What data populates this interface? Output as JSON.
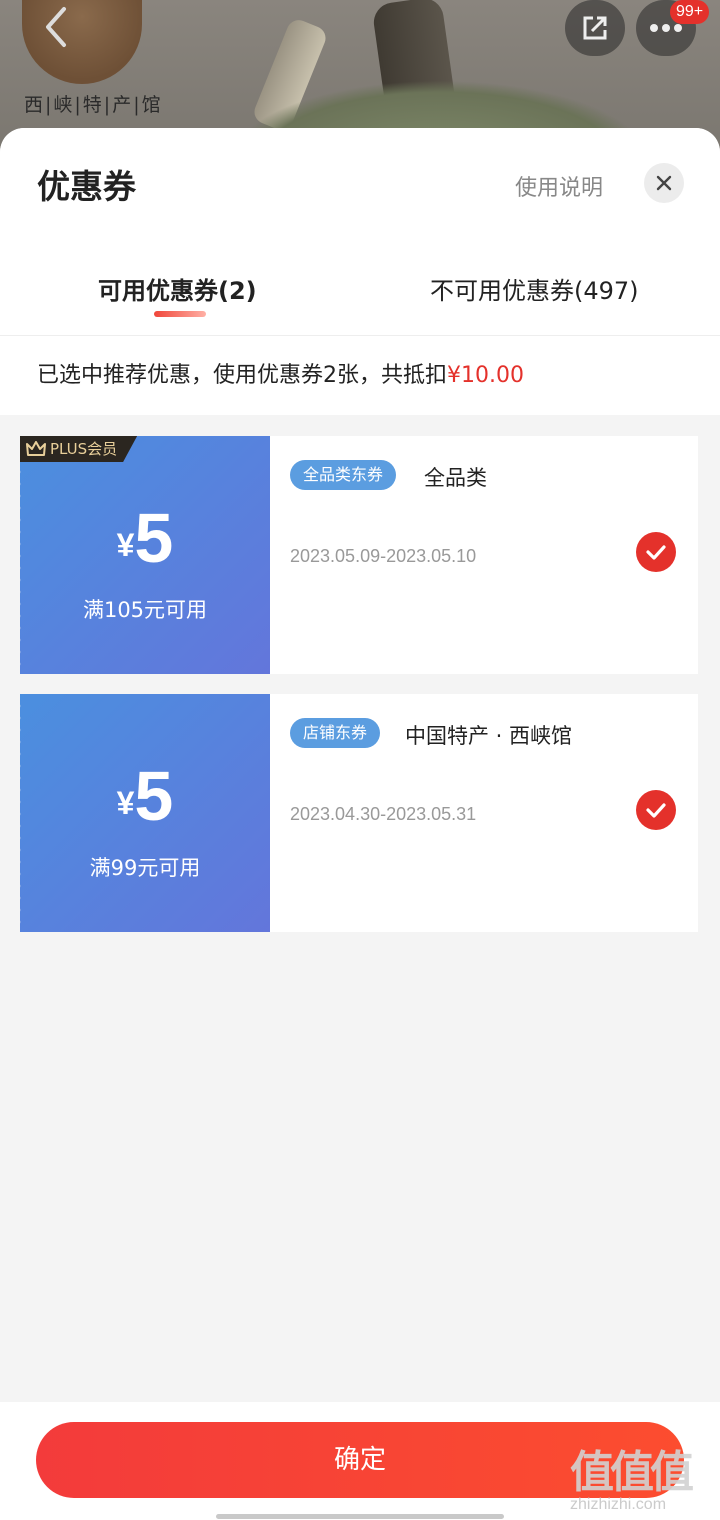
{
  "background": {
    "store_logo_text": "西|峡|特|产|馆",
    "more_badge": "99+"
  },
  "sheet": {
    "title": "优惠券",
    "help_link": "使用说明",
    "tabs": [
      {
        "label": "可用优惠券(2)",
        "active": true
      },
      {
        "label": "不可用优惠券(497)",
        "active": false
      }
    ],
    "summary": {
      "text": "已选中推荐优惠，使用优惠券2张，共抵扣",
      "amount": "¥10.00"
    }
  },
  "coupons": [
    {
      "plus_tag": "PLUS会员",
      "currency": "¥",
      "value": "5",
      "condition": "满105元可用",
      "type_tag": "全品类东券",
      "scope": "全品类",
      "date_range": "2023.05.09-2023.05.10",
      "selected": true
    },
    {
      "currency": "¥",
      "value": "5",
      "condition": "满99元可用",
      "type_tag": "店铺东券",
      "scope": "中国特产 · 西峡馆",
      "date_range": "2023.04.30-2023.05.31",
      "selected": true
    }
  ],
  "footer": {
    "confirm_label": "确定"
  },
  "watermark": {
    "big": "值值值",
    "small": "zhizhizhi.com"
  },
  "colors": {
    "accent_red": "#e4312b",
    "coupon_blue_start": "#4b8fdf",
    "coupon_blue_end": "#6376db"
  }
}
